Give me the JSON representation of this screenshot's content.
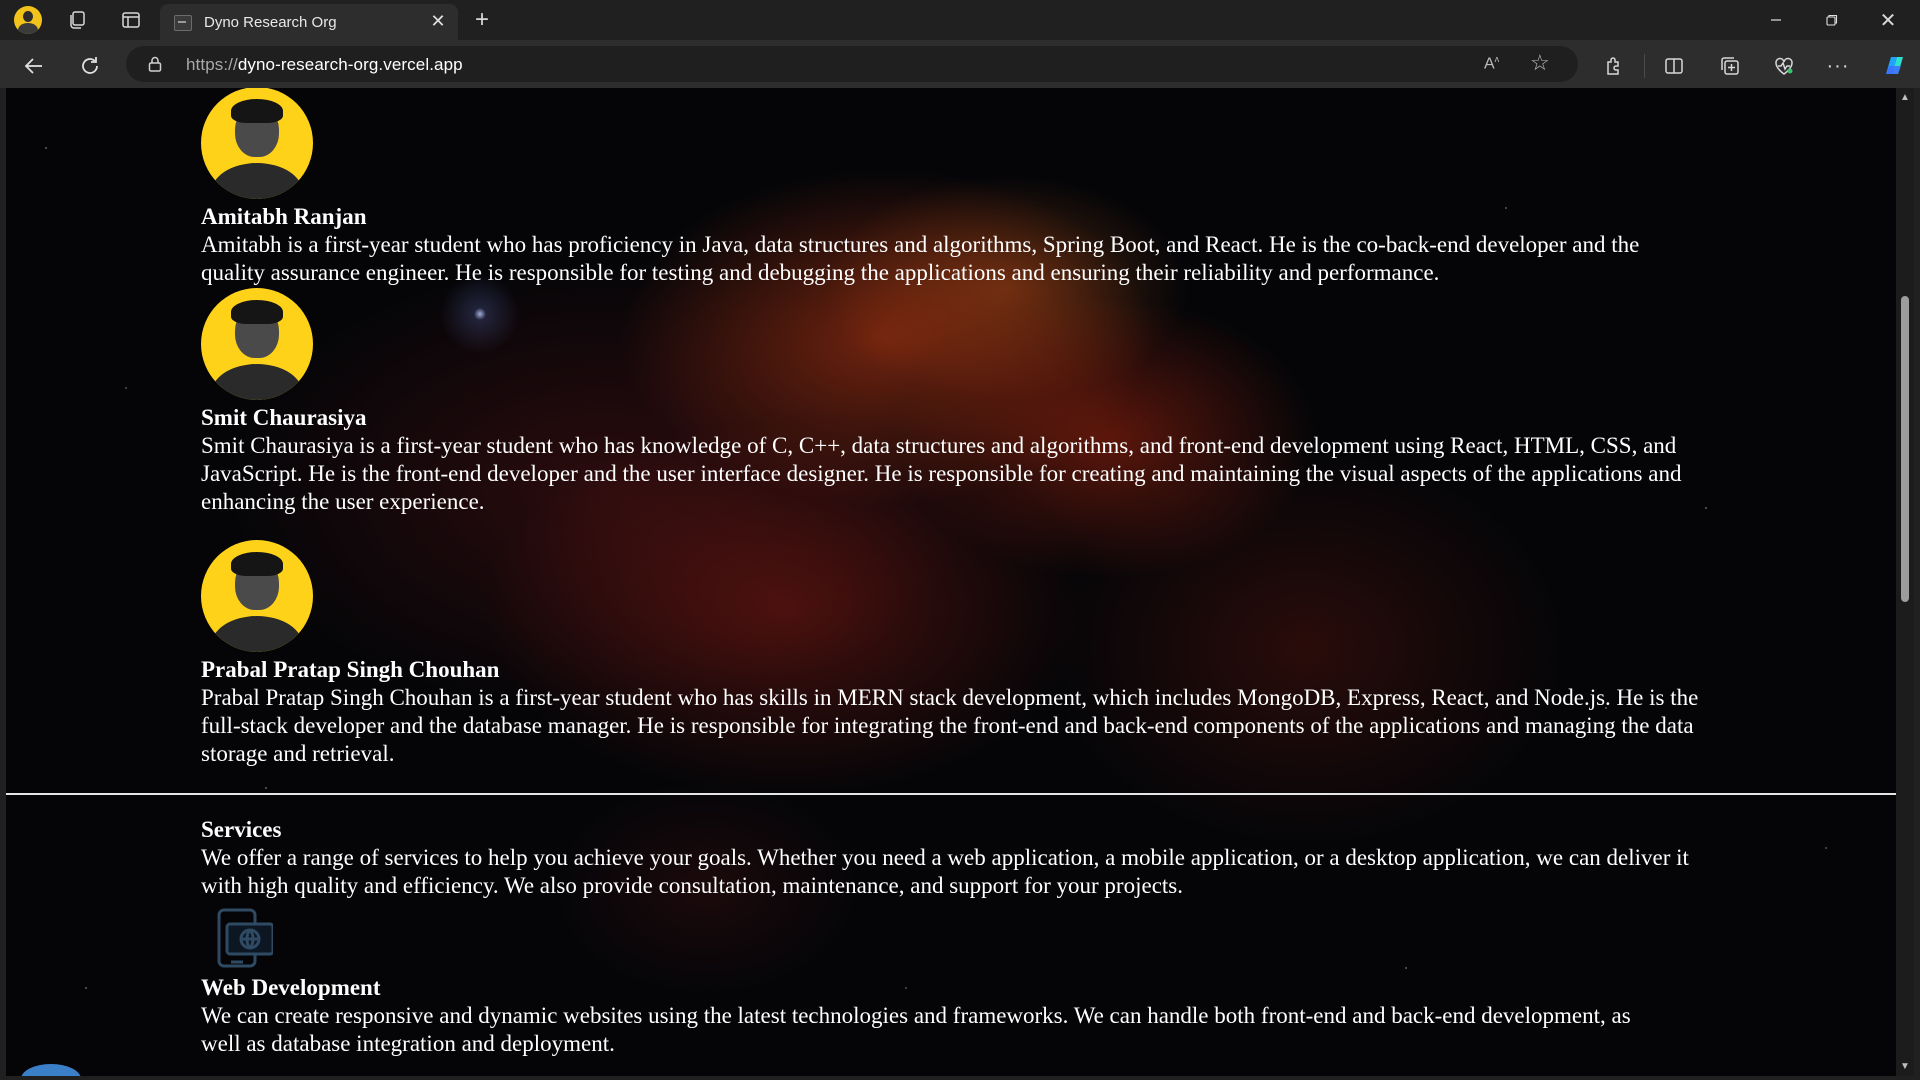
{
  "browser": {
    "tab_title": "Dyno Research Org",
    "url_scheme": "https://",
    "url_host": "dyno-research-org.vercel.app",
    "icons": {
      "profile": "profile-avatar-icon",
      "workspaces": "workspaces-icon",
      "vertical_tabs": "vertical-tabs-icon",
      "favicon": "site-favicon",
      "close_tab": "close-icon",
      "new_tab": "plus-icon",
      "back": "back-arrow-icon",
      "reload": "reload-icon",
      "lock": "lock-icon",
      "read_aloud": "read-aloud-icon",
      "favorite": "star-icon",
      "extensions": "puzzle-icon",
      "split_screen": "split-screen-icon",
      "collections": "collections-icon",
      "browser_essentials": "heart-pulse-icon",
      "more": "more-icon",
      "copilot": "copilot-icon",
      "minimize": "minimize-icon",
      "maximize": "restore-icon",
      "close_window": "close-icon"
    }
  },
  "team": [
    {
      "name": "Amitabh Ranjan",
      "bio": "Amitabh is a first-year student who has proficiency in Java, data structures and algorithms, Spring Boot, and React. He is the co-back-end developer and the quality assurance engineer. He is responsible for testing and debugging the applications and ensuring their reliability and performance."
    },
    {
      "name": "Smit Chaurasiya",
      "bio": "Smit Chaurasiya is a first-year student who has knowledge of C, C++, data structures and algorithms, and front-end development using React, HTML, CSS, and JavaScript. He is the front-end developer and the user interface designer. He is responsible for creating and maintaining the visual aspects of the applications and enhancing the user experience."
    },
    {
      "name": "Prabal Pratap Singh Chouhan",
      "bio": "Prabal Pratap Singh Chouhan is a first-year student who has skills in MERN stack development, which includes MongoDB, Express, React, and Node.js. He is the full-stack developer and the database manager. He is responsible for integrating the front-end and back-end components of the applications and managing the data storage and retrieval."
    }
  ],
  "services": {
    "heading": "Services",
    "intro": "We offer a range of services to help you achieve your goals. Whether you need a web application, a mobile application, or a desktop application, we can deliver it with high quality and efficiency. We also provide consultation, maintenance, and support for your projects.",
    "items": [
      {
        "icon": "web-development-icon",
        "title": "Web Development",
        "text": "We can create responsive and dynamic websites using the latest technologies and frameworks. We can handle both front-end and back-end development, as well as database integration and deployment."
      }
    ]
  },
  "colors": {
    "photo_background": "#ffd21a",
    "page_text": "#ffffff",
    "divider": "#e6e6e6"
  }
}
